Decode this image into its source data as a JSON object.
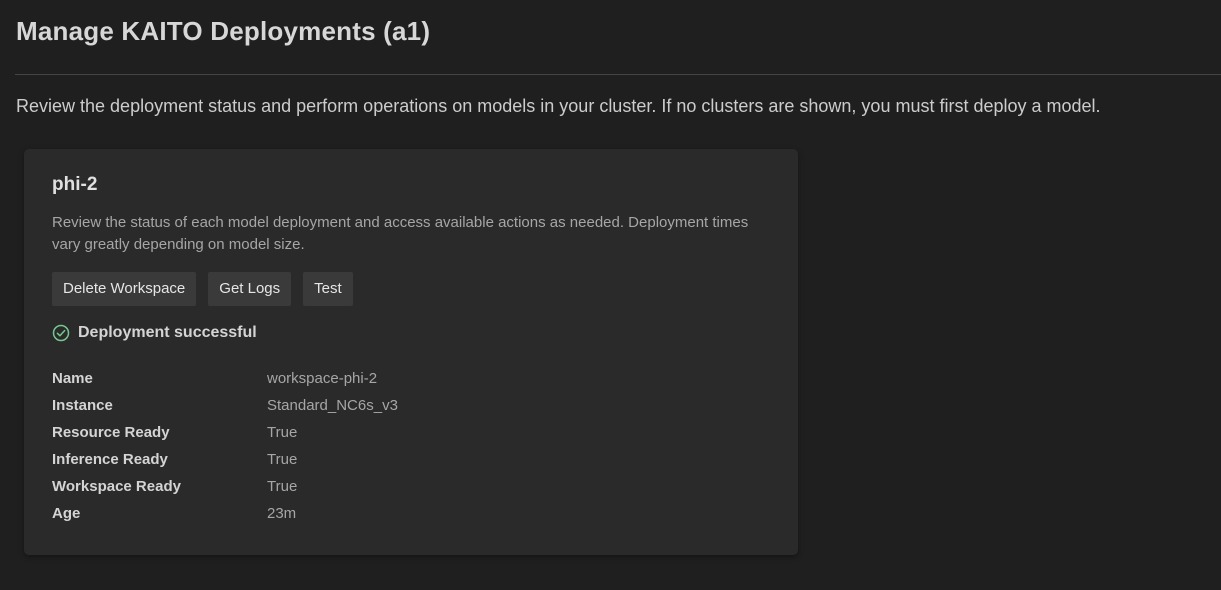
{
  "page": {
    "title": "Manage KAITO Deployments (a1)",
    "intro": "Review the deployment status and perform operations on models in your cluster. If no clusters are shown, you must first deploy a model."
  },
  "card": {
    "model_name": "phi-2",
    "description": "Review the status of each model deployment and access available actions as needed. Deployment times vary greatly depending on model size.",
    "actions": {
      "delete_label": "Delete Workspace",
      "logs_label": "Get Logs",
      "test_label": "Test"
    },
    "status": {
      "icon": "check-circle-icon",
      "text": "Deployment successful",
      "color": "#73c991"
    },
    "details": [
      {
        "key": "Name",
        "value": "workspace-phi-2"
      },
      {
        "key": "Instance",
        "value": "Standard_NC6s_v3"
      },
      {
        "key": "Resource Ready",
        "value": "True"
      },
      {
        "key": "Inference Ready",
        "value": "True"
      },
      {
        "key": "Workspace Ready",
        "value": "True"
      },
      {
        "key": "Age",
        "value": "23m"
      }
    ]
  }
}
